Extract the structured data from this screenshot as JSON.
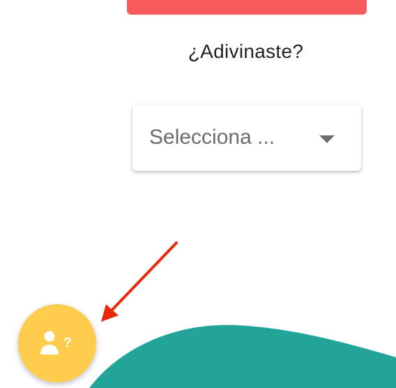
{
  "quiz": {
    "question": "¿Adivinaste?"
  },
  "select": {
    "placeholder": "Selecciona ..."
  },
  "fab": {
    "icon": "person-question-icon"
  },
  "colors": {
    "banner": "#f75b5b",
    "fab": "#ffcc4d",
    "wave": "#22a598",
    "annotation_arrow": "#e8290b"
  }
}
